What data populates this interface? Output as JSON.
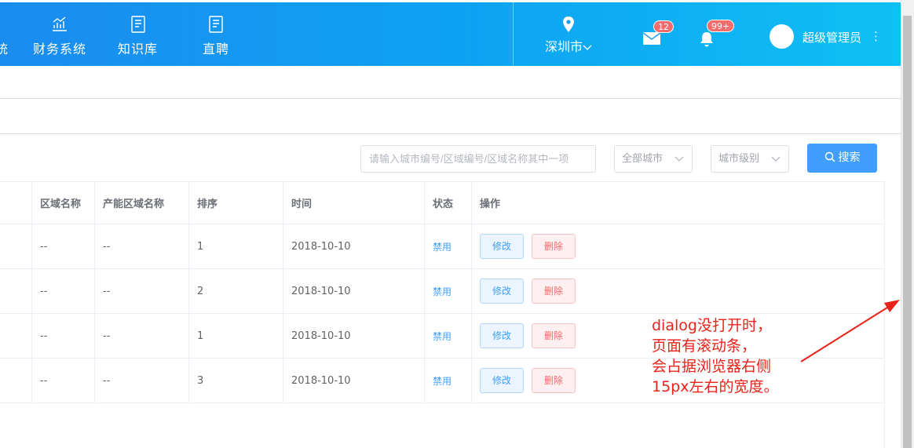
{
  "header": {
    "nav": [
      {
        "label": "统",
        "icon": "none"
      },
      {
        "label": "财务系统",
        "icon": "chart-icon"
      },
      {
        "label": "知识库",
        "icon": "document-icon"
      },
      {
        "label": "直聘",
        "icon": "document-icon"
      }
    ],
    "city": "深圳市",
    "mail_badge": "12",
    "bell_badge": "99+",
    "username": "超级管理员"
  },
  "filters": {
    "search_placeholder": "请输入城市编号/区域编号/区域名称其中一项",
    "city_select": "全部城市",
    "level_select": "城市级别",
    "search_button": "搜索"
  },
  "table": {
    "columns": [
      "区域名称",
      "产能区域名称",
      "排序",
      "时间",
      "状态",
      "操作"
    ],
    "rows": [
      {
        "area": "--",
        "cap_area": "--",
        "order": "1",
        "time": "2018-10-10",
        "status": "禁用",
        "edit": "修改",
        "del": "删除"
      },
      {
        "area": "--",
        "cap_area": "--",
        "order": "2",
        "time": "2018-10-10",
        "status": "禁用",
        "edit": "修改",
        "del": "删除"
      },
      {
        "area": "--",
        "cap_area": "--",
        "order": "1",
        "time": "2018-10-10",
        "status": "禁用",
        "edit": "修改",
        "del": "删除"
      },
      {
        "area": "--",
        "cap_area": "--",
        "order": "3",
        "time": "2018-10-10",
        "status": "禁用",
        "edit": "修改",
        "del": "删除"
      }
    ]
  },
  "annotation": {
    "line1": "dialog没打开时，",
    "line2": "页面有滚动条，",
    "line3": "会占据浏览器右侧",
    "line4": "15px左右的宽度。"
  },
  "colors": {
    "accent": "#409eff",
    "danger": "#f56c6c",
    "annotation": "#e8231a"
  }
}
